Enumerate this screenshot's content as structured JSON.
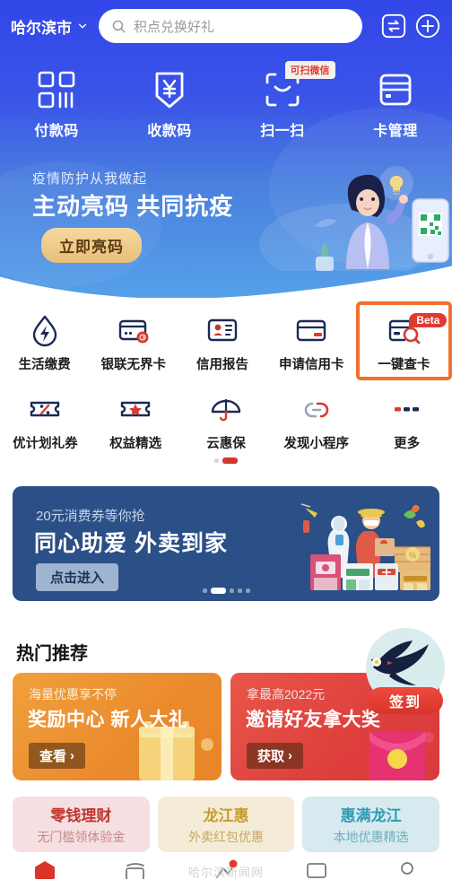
{
  "header": {
    "city": "哈尔滨市",
    "city_chevron_icon": "chevron-down-icon",
    "search_placeholder": "积点兑换好礼",
    "search_icon": "search-icon",
    "transfer_icon": "transfer-icon",
    "add_icon": "plus-circle-icon"
  },
  "quick_actions": [
    {
      "label": "付款码",
      "icon": "qrcode-icon"
    },
    {
      "label": "收款码",
      "icon": "receive-money-icon"
    },
    {
      "label": "扫一扫",
      "icon": "scan-icon",
      "badge": "可扫微信"
    },
    {
      "label": "卡管理",
      "icon": "bank-card-icon"
    }
  ],
  "health_banner": {
    "subtitle": "疫情防护从我做起",
    "title": "主动亮码 共同抗疫",
    "button": "立即亮码",
    "art_icon": "nurse-qr-illustration"
  },
  "service_grid": {
    "row1": [
      {
        "label": "生活缴费",
        "icon": "water-drop-bolt-icon"
      },
      {
        "label": "银联无界卡",
        "icon": "unionpay-card-icon"
      },
      {
        "label": "信用报告",
        "icon": "id-report-icon"
      },
      {
        "label": "申请信用卡",
        "icon": "credit-card-apply-icon"
      },
      {
        "label": "一键查卡",
        "icon": "card-search-icon",
        "badge": "Beta",
        "highlighted": true
      }
    ],
    "row2": [
      {
        "label": "优计划礼券",
        "icon": "coupon-percent-icon"
      },
      {
        "label": "权益精选",
        "icon": "coupon-star-icon"
      },
      {
        "label": "云惠保",
        "icon": "umbrella-icon"
      },
      {
        "label": "发现小程序",
        "icon": "miniprogram-cloud-icon"
      },
      {
        "label": "更多",
        "icon": "more-dots-icon"
      }
    ],
    "pager": {
      "total": 2,
      "active": 2
    }
  },
  "promo_banner": {
    "subtitle": "20元消费券等你抢",
    "title": "同心助爱 外卖到家",
    "button": "点击进入",
    "art_icon": "delivery-street-illustration",
    "pager": {
      "total": 5,
      "active": 2
    }
  },
  "hot_section": {
    "title": "热门推荐",
    "checkin": {
      "label": "签到",
      "icon": "swallow-bird-icon"
    },
    "cards": [
      {
        "subtitle": "海量优惠享不停",
        "title": "奖励中心 新人大礼",
        "button": "查看",
        "chevron": "›",
        "color": "#eb8a2c",
        "art_icon": "gift-box-icon"
      },
      {
        "subtitle": "拿最高2022元",
        "title": "邀请好友拿大奖",
        "button": "获取",
        "chevron": "›",
        "color": "#de3f3c",
        "art_icon": "red-envelope-icon"
      }
    ]
  },
  "tri_cards": [
    {
      "title": "零钱理财",
      "subtitle": "无门槛领体验金",
      "color": "#c2342f"
    },
    {
      "title": "龙江惠",
      "subtitle": "外卖红包优惠",
      "color": "#c99a2e"
    },
    {
      "title": "惠满龙江",
      "subtitle": "本地优惠精选",
      "color": "#2e9bb5"
    }
  ],
  "bottom_nav": [
    {
      "icon": "home-icon",
      "active": true
    },
    {
      "icon": "card-stack-icon",
      "active": false
    },
    {
      "icon": "discover-icon",
      "active": false,
      "has_dot": true
    },
    {
      "icon": "messages-icon",
      "active": false
    },
    {
      "icon": "profile-icon",
      "active": false
    }
  ],
  "watermark": "哈尔滨新闻网"
}
